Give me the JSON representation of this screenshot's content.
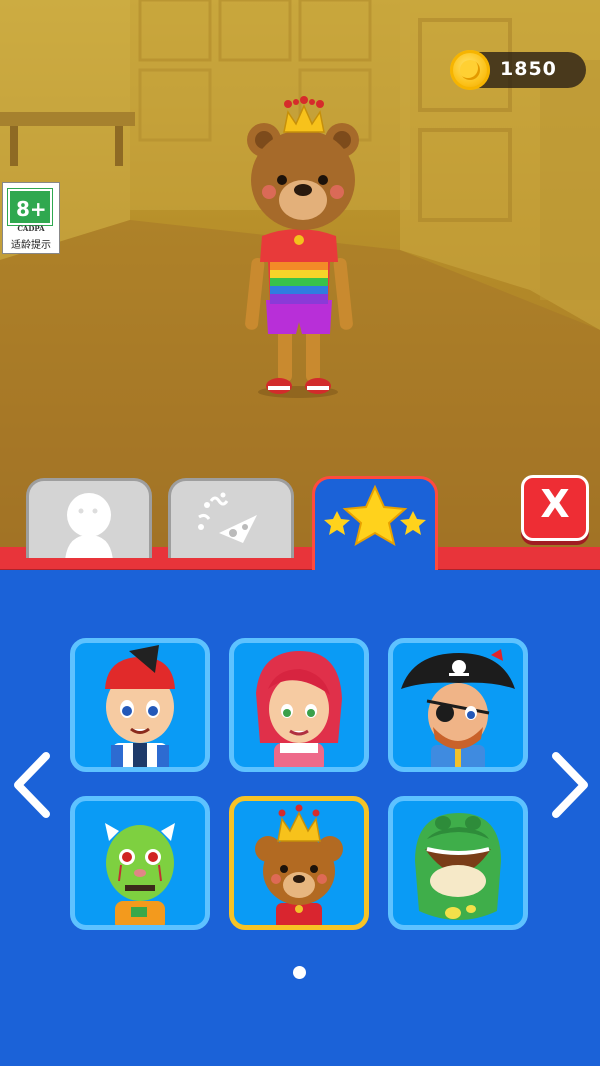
{
  "hud": {
    "coins": "1850",
    "coin_icon": "gold-coin-icon"
  },
  "age_rating": {
    "rating": "8+",
    "org": "CADPA",
    "tip": "适龄提示"
  },
  "character": {
    "name_icon": "bear-king-character"
  },
  "tabs": [
    {
      "icon": "character-silhouette-icon",
      "active": false
    },
    {
      "icon": "confetti-popper-icon",
      "active": false
    },
    {
      "icon": "stars-icon",
      "active": true
    }
  ],
  "close_button": {
    "label": "X"
  },
  "skins": [
    {
      "icon": "boy-red-cap-avatar",
      "selected": false
    },
    {
      "icon": "red-hair-girl-avatar",
      "selected": false
    },
    {
      "icon": "pirate-avatar",
      "selected": false
    },
    {
      "icon": "green-zombie-avatar",
      "selected": false
    },
    {
      "icon": "bear-king-avatar",
      "selected": true
    },
    {
      "icon": "frog-costume-avatar",
      "selected": false
    }
  ],
  "pagination": {
    "current_page": 1,
    "total_pages": 1
  },
  "colors": {
    "panel": "#1b62d8",
    "card": "#0a9bf5",
    "card_border": "#5ec2ff",
    "selected_border": "#f7c325",
    "red_bar": "#e8343a"
  }
}
